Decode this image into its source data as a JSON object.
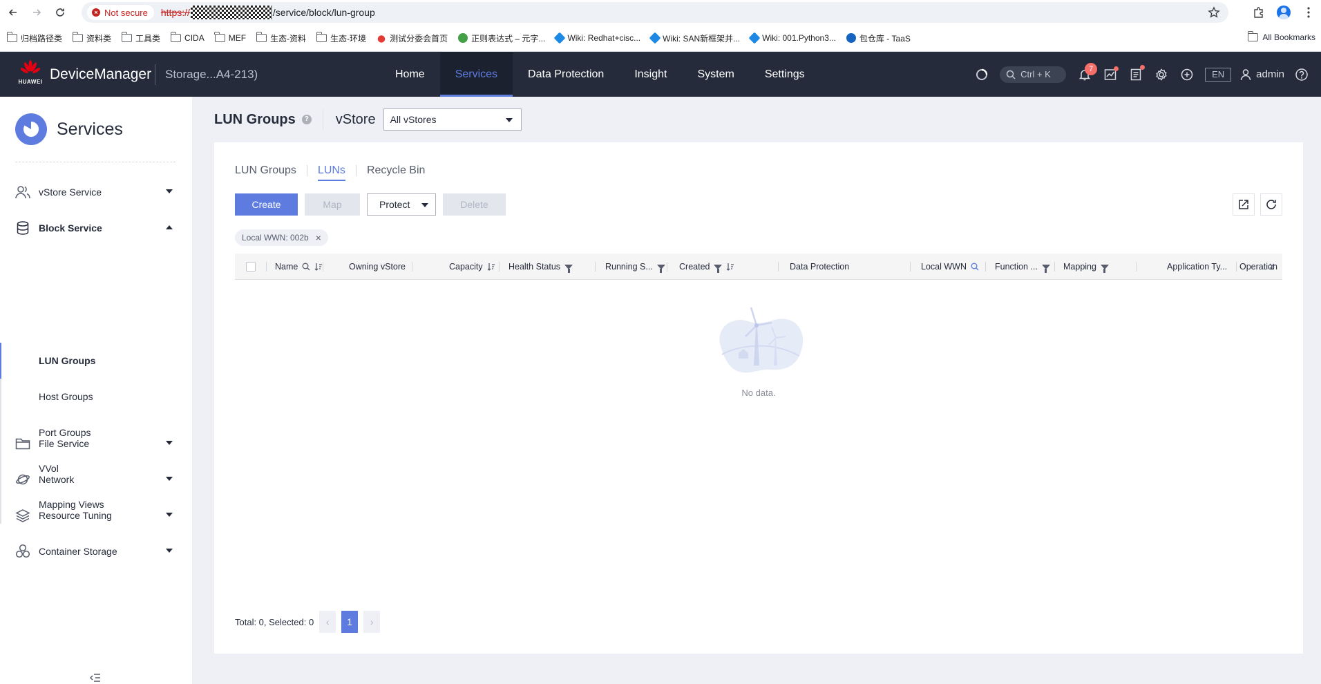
{
  "browser": {
    "not_secure": "Not secure",
    "url_scheme": "https://",
    "url_path": "/service/block/lun-group",
    "bookmarks": [
      {
        "label": "归档路径类",
        "icon": "folder-icon"
      },
      {
        "label": "资料类",
        "icon": "folder-icon"
      },
      {
        "label": "工具类",
        "icon": "folder-icon"
      },
      {
        "label": "CIDA",
        "icon": "folder-icon"
      },
      {
        "label": "MEF",
        "icon": "folder-icon"
      },
      {
        "label": "生态-资料",
        "icon": "folder-icon"
      },
      {
        "label": "生态-环境",
        "icon": "folder-icon"
      },
      {
        "label": "测试分委会首页",
        "icon": "site-icon"
      },
      {
        "label": "正则表达式 – 元字...",
        "icon": "site-icon"
      },
      {
        "label": "Wiki: Redhat+cisc...",
        "icon": "wiki-icon"
      },
      {
        "label": "Wiki: SAN新框架并...",
        "icon": "wiki-icon"
      },
      {
        "label": "Wiki: 001.Python3...",
        "icon": "wiki-icon"
      },
      {
        "label": "包仓库 - TaaS",
        "icon": "site-icon"
      }
    ],
    "all_bookmarks": "All Bookmarks"
  },
  "header": {
    "logo_text": "HUAWEI",
    "product": "DeviceManager",
    "device": "Storage...A4-213)",
    "nav": [
      {
        "label": "Home",
        "active": false
      },
      {
        "label": "Services",
        "active": true
      },
      {
        "label": "Data Protection",
        "active": false
      },
      {
        "label": "Insight",
        "active": false
      },
      {
        "label": "System",
        "active": false
      },
      {
        "label": "Settings",
        "active": false
      }
    ],
    "search_shortcut": "Ctrl + K",
    "alarm_count": "7",
    "language": "EN",
    "user": "admin",
    "accent": "#5e7ce0",
    "badge_color": "#f66f6a"
  },
  "sidebar": {
    "title": "Services",
    "groups": [
      {
        "label": "vStore Service",
        "icon": "vstore-icon"
      },
      {
        "label": "Block Service",
        "icon": "database-icon"
      },
      {
        "label": "File Service",
        "icon": "folder-icon"
      },
      {
        "label": "Network",
        "icon": "planet-icon"
      },
      {
        "label": "Resource Tuning",
        "icon": "layers-icon"
      },
      {
        "label": "Container Storage",
        "icon": "hexagons-icon"
      }
    ],
    "block_items": [
      "LUN Groups",
      "Host Groups",
      "Port Groups",
      "VVol",
      "Mapping Views"
    ]
  },
  "page": {
    "title": "LUN Groups",
    "vstore_label": "vStore",
    "vstore_value": "All vStores",
    "tabs": [
      {
        "label": "LUN Groups",
        "active": false
      },
      {
        "label": "LUNs",
        "active": true
      },
      {
        "label": "Recycle Bin",
        "active": false
      }
    ],
    "toolbar": {
      "create": "Create",
      "map": "Map",
      "protect": "Protect",
      "delete": "Delete"
    },
    "filter_tag": "Local WWN: 002b",
    "columns": [
      "Name",
      "Owning vStore",
      "Capacity",
      "Health Status",
      "Running S...",
      "Created",
      "Data Protection",
      "Local WWN",
      "Function ...",
      "Mapping",
      "Application Ty...",
      "Operation"
    ],
    "empty_text": "No data.",
    "pager": {
      "summary": "Total: 0, Selected: 0",
      "current_page": "1"
    }
  }
}
